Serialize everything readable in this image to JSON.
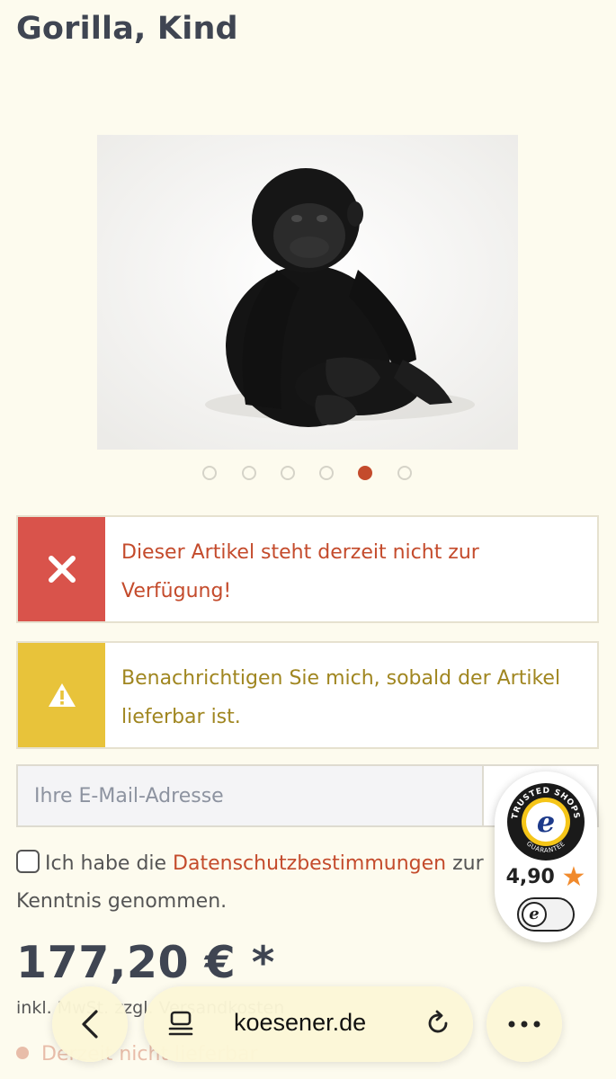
{
  "product": {
    "title": "Gorilla, Kind",
    "image_alt": "Gorilla plush toy"
  },
  "carousel": {
    "count": 6,
    "active_index": 4
  },
  "alerts": {
    "error": {
      "text": "Dieser Artikel steht derzeit nicht zur Verfügung!",
      "icon": "close-icon"
    },
    "warning": {
      "text": "Benachrichtigen Sie mich, sobald der Artikel lieferbar ist.",
      "icon": "warning-icon"
    }
  },
  "notify_form": {
    "email_placeholder": "Ihre E-Mail-Adresse",
    "email_value": "",
    "consent_prefix": "Ich habe die ",
    "consent_link": "Datenschutzbestimmungen",
    "consent_suffix": " zur Kenntnis genommen.",
    "consent_checked": false
  },
  "price": {
    "amount": "177,20 € *",
    "note": "inkl. MwSt. zzgl. Versandkosten"
  },
  "stock": {
    "status": "Derzeit nicht lieferbar"
  },
  "trusted_shops": {
    "seal_top": "TRUSTED SHOPS",
    "seal_bottom": "GUARANTEE",
    "rating": "4,90",
    "toggle_letter": "e"
  },
  "browser": {
    "url": "koesener.de"
  },
  "colors": {
    "background": "#fdfbee",
    "accent": "#c44b2c",
    "error": "#d9534b",
    "warning": "#e8c33a",
    "title": "#3f4552"
  }
}
